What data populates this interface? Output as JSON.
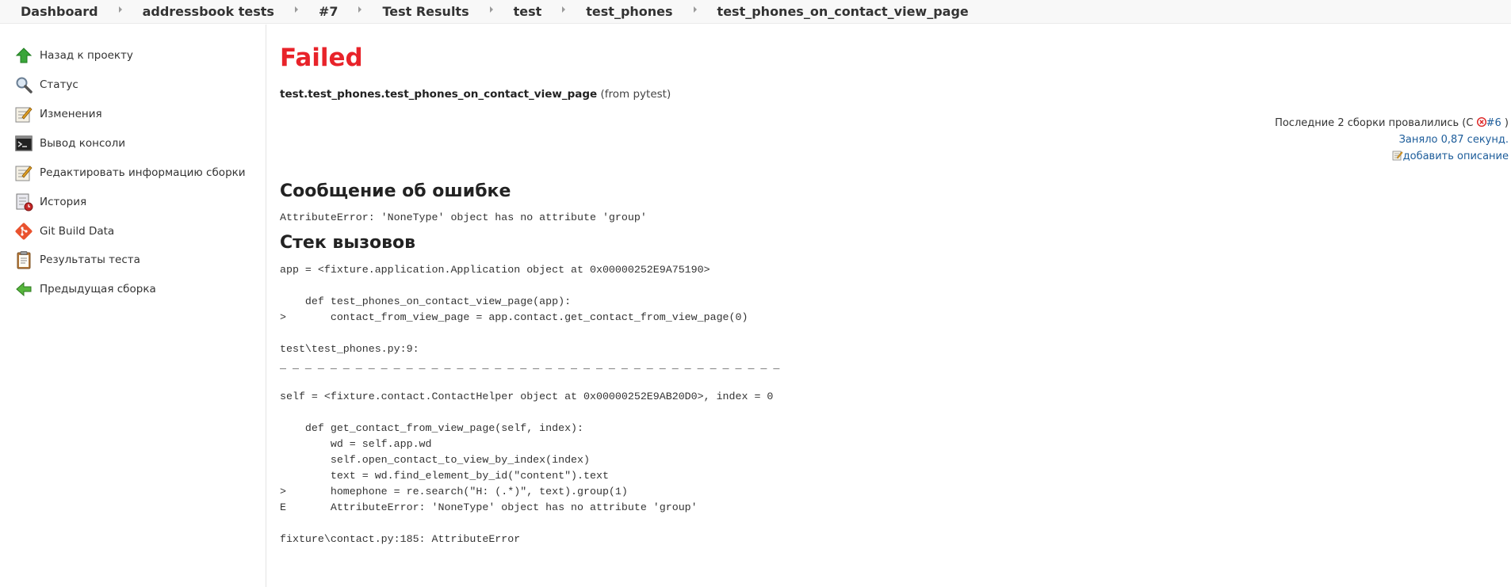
{
  "breadcrumb": [
    "Dashboard",
    "addressbook tests",
    "#7",
    "Test Results",
    "test",
    "test_phones",
    "test_phones_on_contact_view_page"
  ],
  "sidebar": {
    "items": [
      {
        "label": "Назад к проекту",
        "icon": "up-arrow-icon"
      },
      {
        "label": "Статус",
        "icon": "magnifier-icon"
      },
      {
        "label": "Изменения",
        "icon": "notepad-icon"
      },
      {
        "label": "Вывод консоли",
        "icon": "terminal-icon"
      },
      {
        "label": "Редактировать информацию сборки",
        "icon": "notepad-icon"
      },
      {
        "label": "История",
        "icon": "history-icon"
      },
      {
        "label": "Git Build Data",
        "icon": "git-icon"
      },
      {
        "label": "Результаты теста",
        "icon": "clipboard-icon"
      },
      {
        "label": "Предыдущая сборка",
        "icon": "left-arrow-icon"
      }
    ]
  },
  "main": {
    "status": "Failed",
    "test_name": "test.test_phones.test_phones_on_contact_view_page",
    "test_source": "(from pytest)",
    "failing_since_prefix": "Последние 2 сборки провалились (С",
    "failing_since_build": "#6",
    "failing_since_suffix": ")",
    "duration": "Заняло 0,87 секунд.",
    "add_description": "добавить описание",
    "error_heading": "Сообщение об ошибке",
    "error_message": "AttributeError: 'NoneType' object has no attribute 'group'",
    "stack_heading": "Стек вызовов",
    "stacktrace": "app = <fixture.application.Application object at 0x00000252E9A75190>\n\n    def test_phones_on_contact_view_page(app):\n>       contact_from_view_page = app.contact.get_contact_from_view_page(0)\n\ntest\\test_phones.py:9:\n_ _ _ _ _ _ _ _ _ _ _ _ _ _ _ _ _ _ _ _ _ _ _ _ _ _ _ _ _ _ _ _ _ _ _ _ _ _ _ _\n\nself = <fixture.contact.ContactHelper object at 0x00000252E9AB20D0>, index = 0\n\n    def get_contact_from_view_page(self, index):\n        wd = self.app.wd\n        self.open_contact_to_view_by_index(index)\n        text = wd.find_element_by_id(\"content\").text\n>       homephone = re.search(\"H: (.*)\", text).group(1)\nE       AttributeError: 'NoneType' object has no attribute 'group'\n\nfixture\\contact.py:185: AttributeError"
  },
  "colors": {
    "failed": "#e8232a",
    "link": "#1c5c9a"
  }
}
